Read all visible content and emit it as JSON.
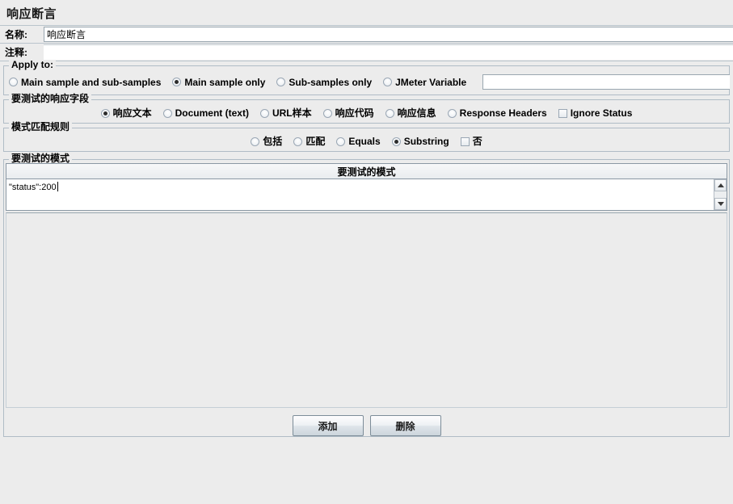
{
  "window": {
    "title": "响应断言"
  },
  "name_row": {
    "label": "名称:",
    "value": "响应断言"
  },
  "comment_row": {
    "label": "注释:",
    "value": ""
  },
  "apply_to": {
    "title": "Apply to:",
    "options": [
      {
        "label": "Main sample and sub-samples",
        "selected": false
      },
      {
        "label": "Main sample only",
        "selected": true
      },
      {
        "label": "Sub-samples only",
        "selected": false
      },
      {
        "label": "JMeter Variable",
        "selected": false
      }
    ],
    "variable_value": ""
  },
  "response_field": {
    "title": "要测试的响应字段",
    "options": [
      {
        "label": "响应文本",
        "selected": true
      },
      {
        "label": "Document (text)",
        "selected": false
      },
      {
        "label": "URL样本",
        "selected": false
      },
      {
        "label": "响应代码",
        "selected": false
      },
      {
        "label": "响应信息",
        "selected": false
      },
      {
        "label": "Response Headers",
        "selected": false
      }
    ],
    "ignore_status": {
      "label": "Ignore Status",
      "checked": false
    }
  },
  "pattern_rule": {
    "title": "模式匹配规则",
    "options": [
      {
        "label": "包括",
        "selected": false
      },
      {
        "label": "匹配",
        "selected": false
      },
      {
        "label": "Equals",
        "selected": false
      },
      {
        "label": "Substring",
        "selected": true
      }
    ],
    "negate": {
      "label": "否",
      "checked": false
    }
  },
  "patterns": {
    "title": "要测试的模式",
    "column_header": "要测试的模式",
    "rows": [
      {
        "value": "\"status\":200"
      }
    ]
  },
  "buttons": {
    "add": "添加",
    "delete": "删除"
  },
  "scrollbar": {
    "up_icon": "triangle-up-icon",
    "down_icon": "triangle-down-icon"
  }
}
